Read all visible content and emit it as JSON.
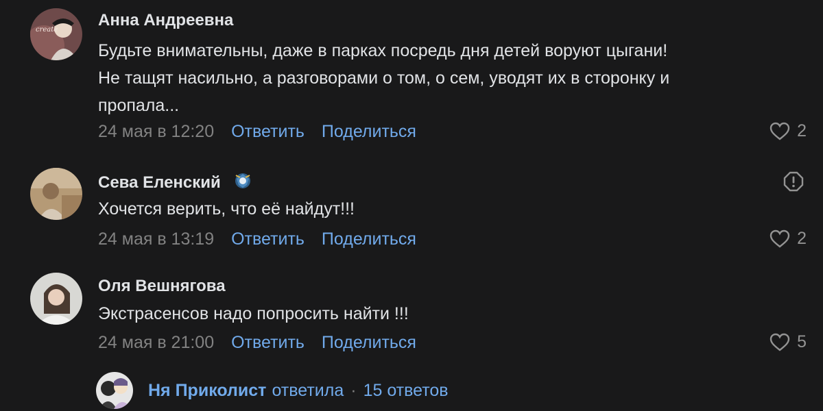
{
  "comments": [
    {
      "author": "Анна Андреевна",
      "lines": [
        "Будьте внимательны, даже в парках посредь дня детей воруют цыгани!",
        "Не тащят насильно, а разговорами о том, о сем, уводят их в сторонку и",
        "пропала..."
      ],
      "date": "24 мая в 12:20",
      "reply_label": "Ответить",
      "share_label": "Поделиться",
      "likes": "2",
      "avatar_text": "create"
    },
    {
      "author": "Сева Еленский",
      "lines": [
        "Хочется верить, что её найдут!!!"
      ],
      "date": "24 мая в 13:19",
      "reply_label": "Ответить",
      "share_label": "Поделиться",
      "likes": "2"
    },
    {
      "author": "Оля Вешнягова",
      "lines": [
        "Экстрасенсов надо попросить найти !!!"
      ],
      "date": "24 мая в 21:00",
      "reply_label": "Ответить",
      "share_label": "Поделиться",
      "likes": "5"
    }
  ],
  "thread": {
    "author": "Ня Приколист",
    "verb": "ответила",
    "separator": "·",
    "replies": "15 ответов"
  },
  "colors": {
    "background": "#19191a",
    "text": "#e1e3e6",
    "secondary": "#828282",
    "link": "#71aaeb"
  }
}
